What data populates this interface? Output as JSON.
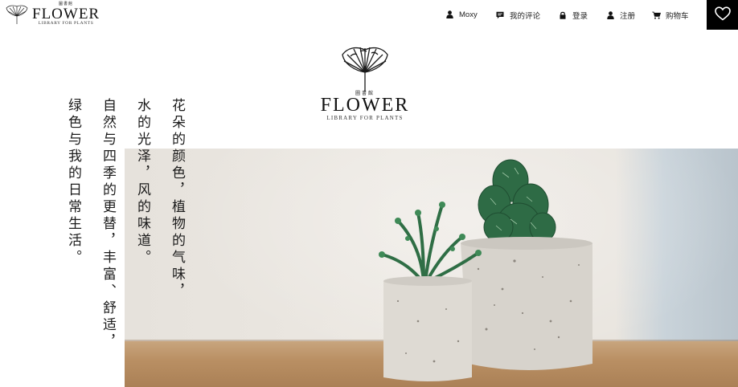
{
  "brand": {
    "small": "圖書館",
    "name": "FLOWER",
    "subtitle": "LIBRARY FOR PLANTS"
  },
  "nav": {
    "user": "Moxy",
    "reviews": "我的评论",
    "login": "登录",
    "register": "注册",
    "cart": "购物车"
  },
  "hero_logo": {
    "small": "圖書館",
    "name": "FLOWER",
    "subtitle": "LIBRARY FOR PLANTS"
  },
  "poem": [
    "花朵的颜色，植物的气味，",
    "水的光泽，风的味道。",
    "自然与四季的更替，丰富、舒适，",
    "绿色与我的日常生活。"
  ],
  "icons": {
    "user": "user-icon",
    "reviews": "comment-icon",
    "login": "lock-icon",
    "register": "user-add-icon",
    "cart": "cart-icon",
    "favorite": "heart-icon",
    "logo": "ginkgo-leaf-icon"
  },
  "colors": {
    "fav_bg": "#000000",
    "text": "#222222",
    "plant_green": "#2e6b45",
    "pot": "#dcd8d1",
    "table": "#b98f63"
  }
}
